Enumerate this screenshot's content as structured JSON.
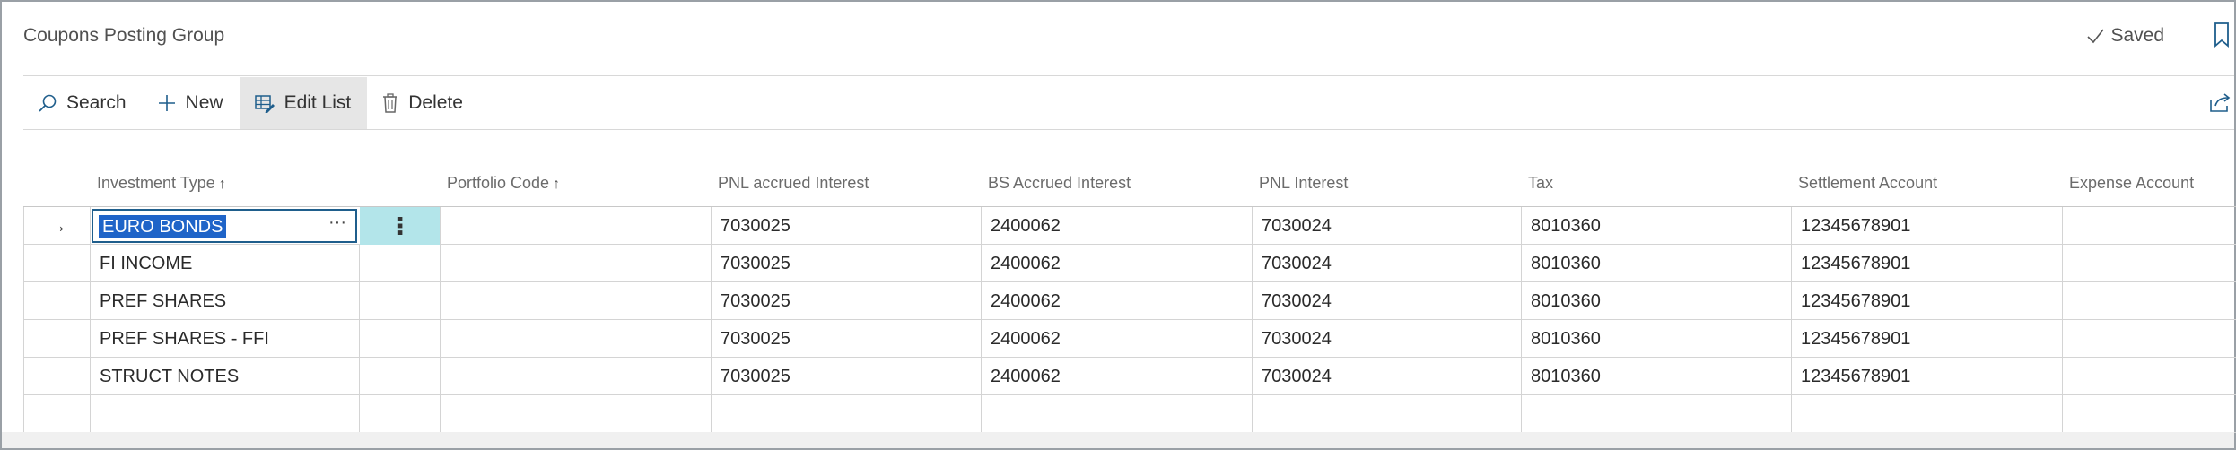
{
  "header": {
    "title": "Coupons Posting Group",
    "saved_label": "Saved",
    "icons": {
      "saved": "checkmark-icon",
      "bookmark": "bookmark-icon"
    }
  },
  "actionbar": {
    "actions": [
      {
        "label": "Search",
        "icon": "search-icon"
      },
      {
        "label": "New",
        "icon": "plus-icon"
      },
      {
        "label": "Edit List",
        "icon": "edit-list-icon",
        "active": true
      },
      {
        "label": "Delete",
        "icon": "trash-icon"
      }
    ],
    "share_icon": "share-icon"
  },
  "grid": {
    "columns": [
      {
        "label": "Investment Type",
        "sort": "↑"
      },
      {
        "label": "Portfolio Code",
        "sort": "↑"
      },
      {
        "label": "PNL accrued Interest",
        "sort": ""
      },
      {
        "label": "BS Accrued Interest",
        "sort": ""
      },
      {
        "label": "PNL Interest",
        "sort": ""
      },
      {
        "label": "Tax",
        "sort": ""
      },
      {
        "label": "Settlement Account",
        "sort": ""
      },
      {
        "label": "Expense Account",
        "sort": ""
      }
    ],
    "selected_row_indicator": "→",
    "row_menu_glyph": "⋮",
    "lookup_glyph": "···",
    "rows": [
      {
        "investment_type": "EURO BONDS",
        "portfolio_code": "",
        "pnl_accrued_interest": "7030025",
        "bs_accrued_interest": "2400062",
        "pnl_interest": "7030024",
        "tax": "8010360",
        "settlement_account": "12345678901",
        "expense_account": ""
      },
      {
        "investment_type": "FI INCOME",
        "portfolio_code": "",
        "pnl_accrued_interest": "7030025",
        "bs_accrued_interest": "2400062",
        "pnl_interest": "7030024",
        "tax": "8010360",
        "settlement_account": "12345678901",
        "expense_account": ""
      },
      {
        "investment_type": "PREF SHARES",
        "portfolio_code": "",
        "pnl_accrued_interest": "7030025",
        "bs_accrued_interest": "2400062",
        "pnl_interest": "7030024",
        "tax": "8010360",
        "settlement_account": "12345678901",
        "expense_account": ""
      },
      {
        "investment_type": "PREF SHARES - FFI",
        "portfolio_code": "",
        "pnl_accrued_interest": "7030025",
        "bs_accrued_interest": "2400062",
        "pnl_interest": "7030024",
        "tax": "8010360",
        "settlement_account": "12345678901",
        "expense_account": ""
      },
      {
        "investment_type": "STRUCT NOTES",
        "portfolio_code": "",
        "pnl_accrued_interest": "7030025",
        "bs_accrued_interest": "2400062",
        "pnl_interest": "7030024",
        "tax": "8010360",
        "settlement_account": "12345678901",
        "expense_account": ""
      },
      {
        "investment_type": "",
        "portfolio_code": "",
        "pnl_accrued_interest": "",
        "bs_accrued_interest": "",
        "pnl_interest": "",
        "tax": "",
        "settlement_account": "",
        "expense_account": ""
      }
    ]
  },
  "colors": {
    "selection": "#1f64c8",
    "menu_cell": "#b3e5ea",
    "active_action": "#e6e6e6",
    "edit_border": "#1f5e8c"
  }
}
